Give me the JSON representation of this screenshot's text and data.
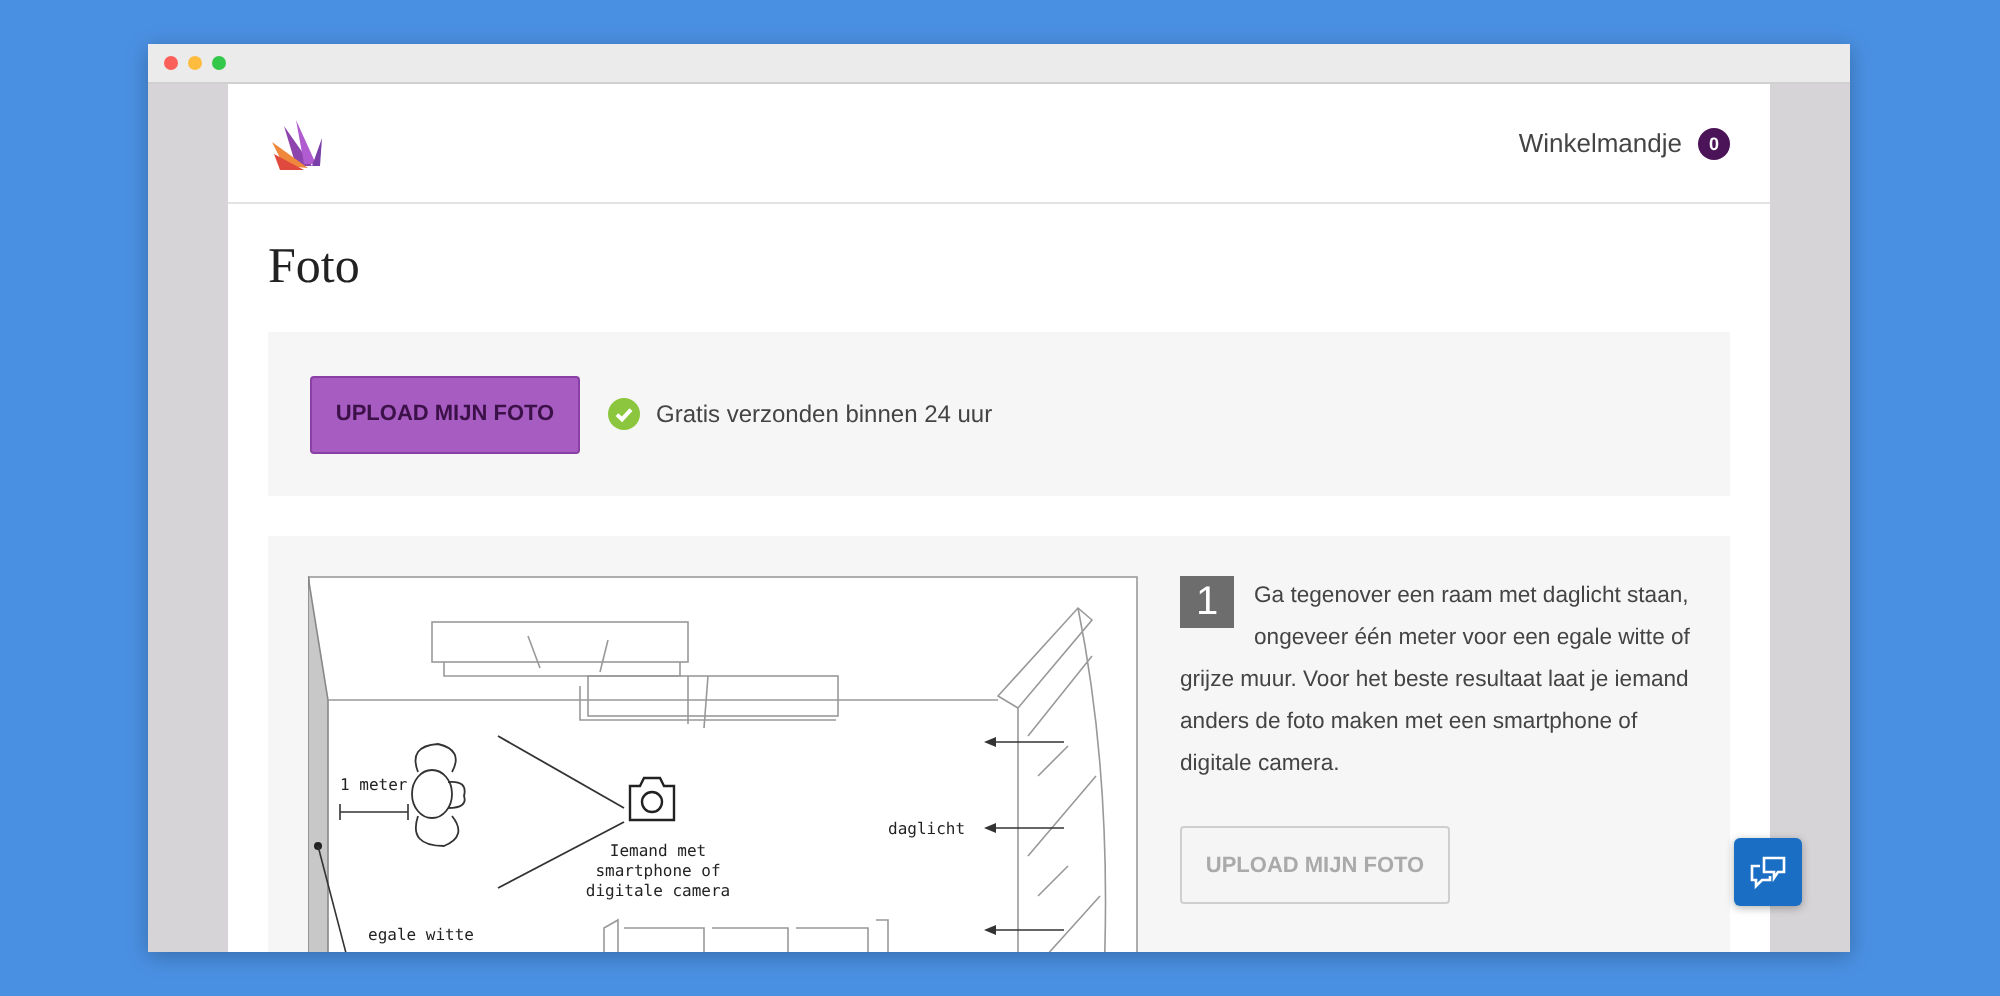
{
  "header": {
    "cart_label": "Winkelmandje",
    "cart_count": "0"
  },
  "page_title": "Foto",
  "upload_bar": {
    "button": {
      "label": "UPLOAD MIJN FOTO",
      "disabled": false
    },
    "note": "Gratis verzonden binnen 24 uur"
  },
  "step": {
    "number": "1",
    "text": "Ga tegenover een raam met daglicht staan, ongeveer één meter voor een egale witte of grijze muur. Voor het beste resultaat laat je iemand anders de foto maken met een smartphone of digitale camera.",
    "button": {
      "label": "UPLOAD MIJN FOTO",
      "disabled": true
    }
  },
  "diagram": {
    "distance_label": "1 meter",
    "camera_label": [
      "Iemand met",
      "smartphone of",
      "digitale camera"
    ],
    "light_label": "daglicht",
    "wall_label": "egale witte"
  }
}
